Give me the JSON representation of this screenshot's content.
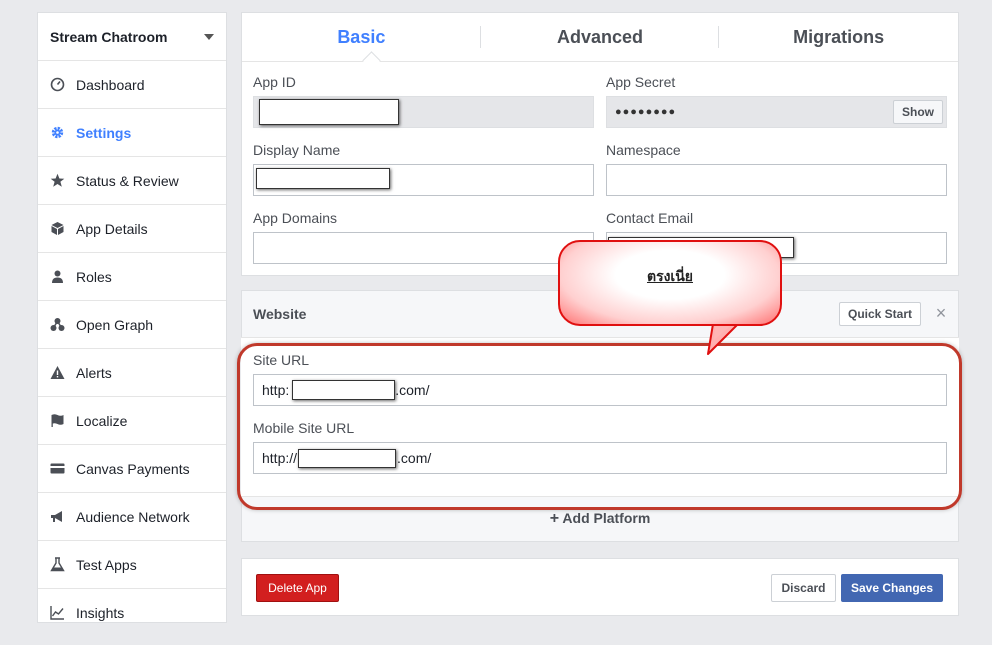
{
  "sidebar": {
    "app_name": "Stream Chatroom",
    "items": [
      {
        "label": "Dashboard",
        "icon": "dashboard-icon",
        "active": false
      },
      {
        "label": "Settings",
        "icon": "gear-icon",
        "active": true
      },
      {
        "label": "Status & Review",
        "icon": "star-icon",
        "active": false
      },
      {
        "label": "App Details",
        "icon": "box-icon",
        "active": false
      },
      {
        "label": "Roles",
        "icon": "person-icon",
        "active": false
      },
      {
        "label": "Open Graph",
        "icon": "graph-icon",
        "active": false
      },
      {
        "label": "Alerts",
        "icon": "warning-icon",
        "active": false
      },
      {
        "label": "Localize",
        "icon": "flag-icon",
        "active": false
      },
      {
        "label": "Canvas Payments",
        "icon": "card-icon",
        "active": false
      },
      {
        "label": "Audience Network",
        "icon": "megaphone-icon",
        "active": false
      },
      {
        "label": "Test Apps",
        "icon": "flask-icon",
        "active": false
      },
      {
        "label": "Insights",
        "icon": "chart-icon",
        "active": false
      }
    ]
  },
  "tabs": {
    "basic": "Basic",
    "advanced": "Advanced",
    "migrations": "Migrations"
  },
  "basic": {
    "app_id_label": "App ID",
    "app_secret_label": "App Secret",
    "app_secret_value": "●●●●●●●●",
    "show_button": "Show",
    "display_name_label": "Display Name",
    "namespace_label": "Namespace",
    "app_domains_label": "App Domains",
    "contact_email_label": "Contact Email"
  },
  "website": {
    "title": "Website",
    "quick_start": "Quick Start",
    "close": "×",
    "site_url_label": "Site URL",
    "site_url_prefix": "http:",
    "site_url_suffix": ".com/",
    "mobile_site_url_label": "Mobile Site URL",
    "mobile_url_prefix": "http://",
    "mobile_url_suffix": ".com/"
  },
  "add_platform": "Add Platform",
  "footer": {
    "delete_app": "Delete App",
    "discard": "Discard",
    "save_changes": "Save Changes"
  },
  "callout": {
    "text": "ตรงเนี่ย"
  },
  "colors": {
    "accent": "#4080ff",
    "primary_button": "#4267b2",
    "danger_button": "#d21f1f",
    "annotation_red": "#c0392b"
  }
}
